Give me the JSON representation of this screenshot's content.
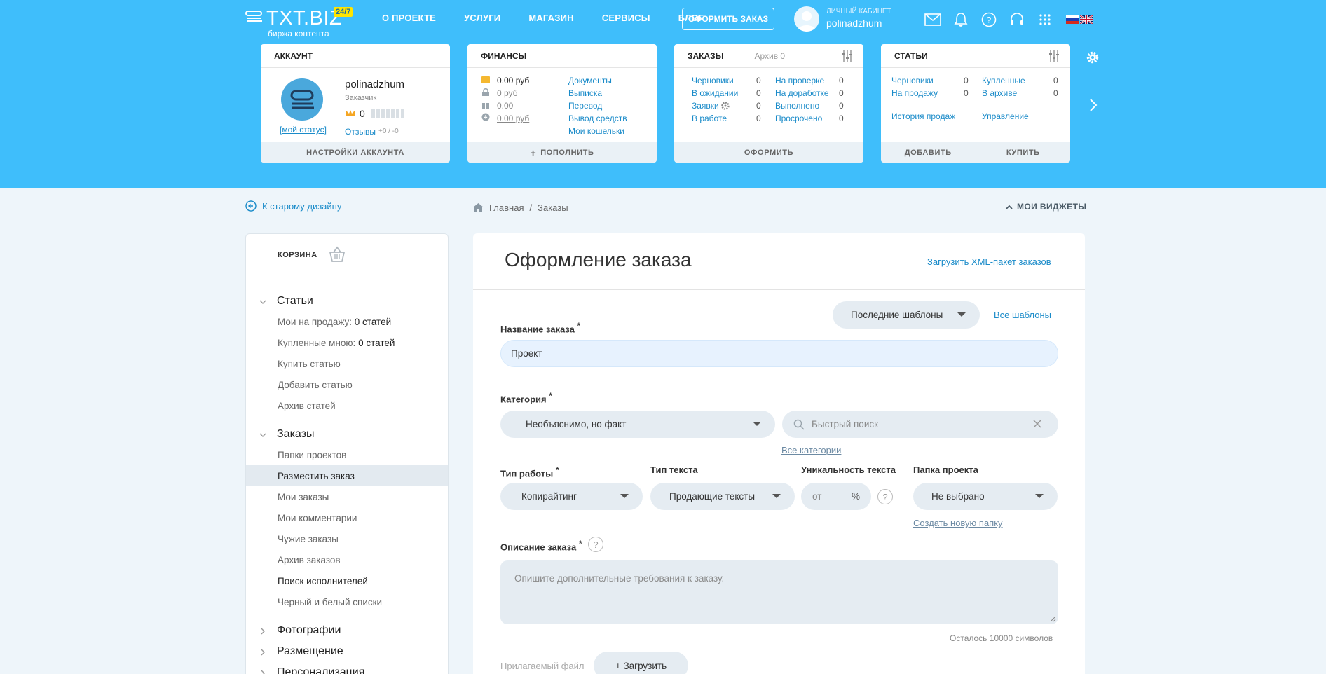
{
  "header": {
    "brand": "TXT.BIZ",
    "badge": "24/7",
    "subtitle": "биржа контента",
    "nav": [
      "О ПРОЕКТЕ",
      "УСЛУГИ",
      "МАГАЗИН",
      "СЕРВИСЫ",
      "БЛОГ"
    ],
    "order_button": "ОФОРМИТЬ ЗАКАЗ",
    "cabinet_label": "ЛИЧНЫЙ КАБИНЕТ",
    "username": "polinadzhum"
  },
  "widgets": {
    "account": {
      "title": "АККАУНТ",
      "username": "polinadzhum",
      "role": "Заказчик",
      "rating": "0",
      "status_link": "[мой статус]",
      "reviews_label": "Отзывы",
      "reviews_value": "+0 / -0",
      "footer": "НАСТРОЙКИ АККАУНТА"
    },
    "finance": {
      "title": "ФИНАНСЫ",
      "balances": [
        "0.00 руб",
        "0 руб",
        "0.00",
        "0.00 руб"
      ],
      "links": [
        "Документы",
        "Выписка",
        "Перевод",
        "Вывод средств",
        "Мои кошельки"
      ],
      "footer": "ПОПОЛНИТЬ"
    },
    "orders": {
      "title": "ЗАКАЗЫ",
      "archive": "Архив 0",
      "left": [
        {
          "label": "Черновики",
          "count": "0"
        },
        {
          "label": "В ожидании",
          "count": "0"
        },
        {
          "label": "Заявки",
          "count": "0"
        },
        {
          "label": "В работе",
          "count": "0"
        }
      ],
      "right": [
        {
          "label": "На проверке",
          "count": "0"
        },
        {
          "label": "На доработке",
          "count": "0"
        },
        {
          "label": "Выполнено",
          "count": "0"
        },
        {
          "label": "Просрочено",
          "count": "0"
        }
      ],
      "footer": "ОФОРМИТЬ"
    },
    "articles": {
      "title": "СТАТЬИ",
      "left": [
        {
          "label": "Черновики",
          "count": "0"
        },
        {
          "label": "На продажу",
          "count": "0"
        }
      ],
      "right": [
        {
          "label": "Купленные",
          "count": "0"
        },
        {
          "label": "В архиве",
          "count": "0"
        }
      ],
      "history": "История продаж",
      "manage": "Управление",
      "footer_add": "ДОБАВИТЬ",
      "footer_buy": "КУПИТЬ"
    }
  },
  "nav2": {
    "old_design": "К старому дизайну",
    "breadcrumb": [
      "Главная",
      "Заказы"
    ],
    "my_widgets": "МОИ ВИДЖЕТЫ"
  },
  "sidebar": {
    "cart": "КОРЗИНА",
    "articles_title": "Статьи",
    "articles_items": [
      {
        "label": "Мои на продажу:",
        "value": "0 статей"
      },
      {
        "label": "Купленные мною:",
        "value": "0 статей"
      },
      {
        "label": "Купить статью",
        "value": ""
      },
      {
        "label": "Добавить статью",
        "value": ""
      },
      {
        "label": "Архив статей",
        "value": ""
      }
    ],
    "orders_title": "Заказы",
    "orders_items": [
      "Папки проектов",
      "Разместить заказ",
      "Мои заказы",
      "Мои комментарии",
      "Чужие заказы",
      "Архив заказов",
      "Поиск исполнителей",
      "Черный и белый списки"
    ],
    "photos_title": "Фотографии",
    "placement_title": "Размещение",
    "personal_title": "Персонализация"
  },
  "form": {
    "title": "Оформление заказа",
    "xml_link": "Загрузить XML-пакет заказов",
    "templates_select": "Последние шаблоны",
    "all_templates": "Все шаблоны",
    "name_label": "Название заказа",
    "name_value": "Проект",
    "category_label": "Категория",
    "category_value": "Необъяснимо, но факт",
    "search_placeholder": "Быстрый поиск",
    "all_categories": "Все категории",
    "work_type_label": "Тип работы",
    "work_type_value": "Копирайтинг",
    "text_type_label": "Тип текста",
    "text_type_value": "Продающие тексты",
    "uniq_label": "Уникальность текста",
    "uniq_from": "от",
    "uniq_unit": "%",
    "folder_label": "Папка проекта",
    "folder_value": "Не выбрано",
    "new_folder": "Создать новую папку",
    "desc_label": "Описание заказа",
    "desc_placeholder": "Опишите дополнительные требования к заказу.",
    "remaining": "Осталось 10000 символов",
    "attach_label": "Прилагаемый файл",
    "upload": "+ Загрузить",
    "required_mark": "*",
    "help_mark": "?"
  },
  "colors": {
    "header_bg": "#3fbefb",
    "link": "#1a8bc9",
    "page_bg": "#eef5fa"
  }
}
